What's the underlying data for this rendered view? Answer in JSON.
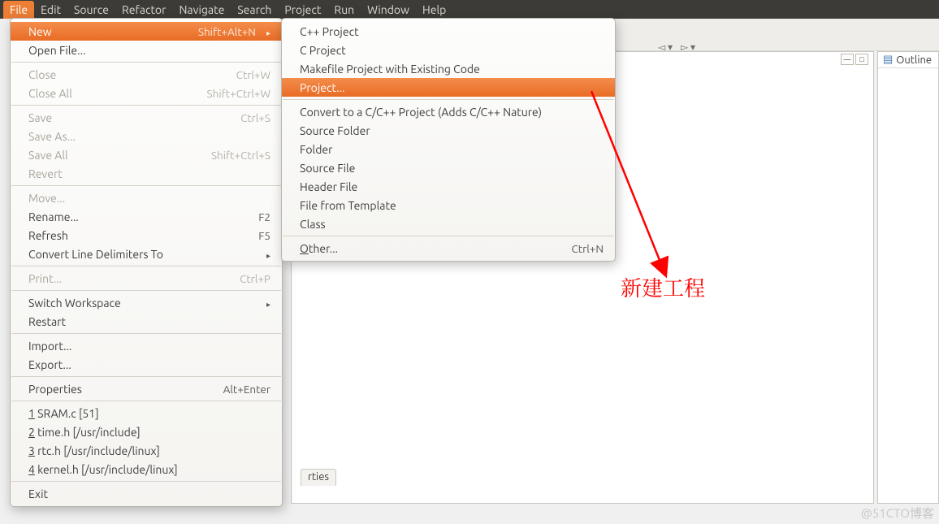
{
  "menubar": [
    "File",
    "Edit",
    "Source",
    "Refactor",
    "Navigate",
    "Search",
    "Project",
    "Run",
    "Window",
    "Help"
  ],
  "active_menu_index": 0,
  "file_menu": {
    "groups": [
      [
        {
          "label": "New",
          "shortcut": "Shift+Alt+N",
          "submenu": true,
          "highlight": true
        },
        {
          "label": "Open File..."
        }
      ],
      [
        {
          "label": "Close",
          "shortcut": "Ctrl+W",
          "disabled": true
        },
        {
          "label": "Close All",
          "shortcut": "Shift+Ctrl+W",
          "disabled": true
        }
      ],
      [
        {
          "label": "Save",
          "shortcut": "Ctrl+S",
          "disabled": true
        },
        {
          "label": "Save As...",
          "disabled": true
        },
        {
          "label": "Save All",
          "shortcut": "Shift+Ctrl+S",
          "disabled": true
        },
        {
          "label": "Revert",
          "disabled": true
        }
      ],
      [
        {
          "label": "Move...",
          "disabled": true
        },
        {
          "label": "Rename...",
          "shortcut": "F2"
        },
        {
          "label": "Refresh",
          "shortcut": "F5"
        },
        {
          "label": "Convert Line Delimiters To",
          "submenu": true
        }
      ],
      [
        {
          "label": "Print...",
          "shortcut": "Ctrl+P",
          "disabled": true
        }
      ],
      [
        {
          "label": "Switch Workspace",
          "submenu": true
        },
        {
          "label": "Restart"
        }
      ],
      [
        {
          "label": "Import..."
        },
        {
          "label": "Export..."
        }
      ],
      [
        {
          "label": "Properties",
          "shortcut": "Alt+Enter"
        }
      ],
      [
        {
          "label": "1 SRAM.c  [51]",
          "ul": true
        },
        {
          "label": "2 time.h  [/usr/include]",
          "ul": true
        },
        {
          "label": "3 rtc.h  [/usr/include/linux]",
          "ul": true
        },
        {
          "label": "4 kernel.h  [/usr/include/linux]",
          "ul": true
        }
      ],
      [
        {
          "label": "Exit"
        }
      ]
    ]
  },
  "new_submenu": {
    "groups": [
      [
        {
          "label": "C++ Project"
        },
        {
          "label": "C Project"
        },
        {
          "label": "Makefile Project with Existing Code"
        },
        {
          "label": "Project...",
          "highlight": true
        }
      ],
      [
        {
          "label": "Convert to a C/C++ Project (Adds C/C++ Nature)"
        },
        {
          "label": "Source Folder"
        },
        {
          "label": "Folder"
        },
        {
          "label": "Source File"
        },
        {
          "label": "Header File"
        },
        {
          "label": "File from Template"
        },
        {
          "label": "Class"
        }
      ],
      [
        {
          "label": "Other...",
          "shortcut": "Ctrl+N",
          "ul": true
        }
      ]
    ]
  },
  "outline": {
    "title": "Outline"
  },
  "bottom_tab": {
    "label_fragment": "rties"
  },
  "annotation": {
    "text": "新建工程"
  },
  "watermark": "@51CTO博客"
}
